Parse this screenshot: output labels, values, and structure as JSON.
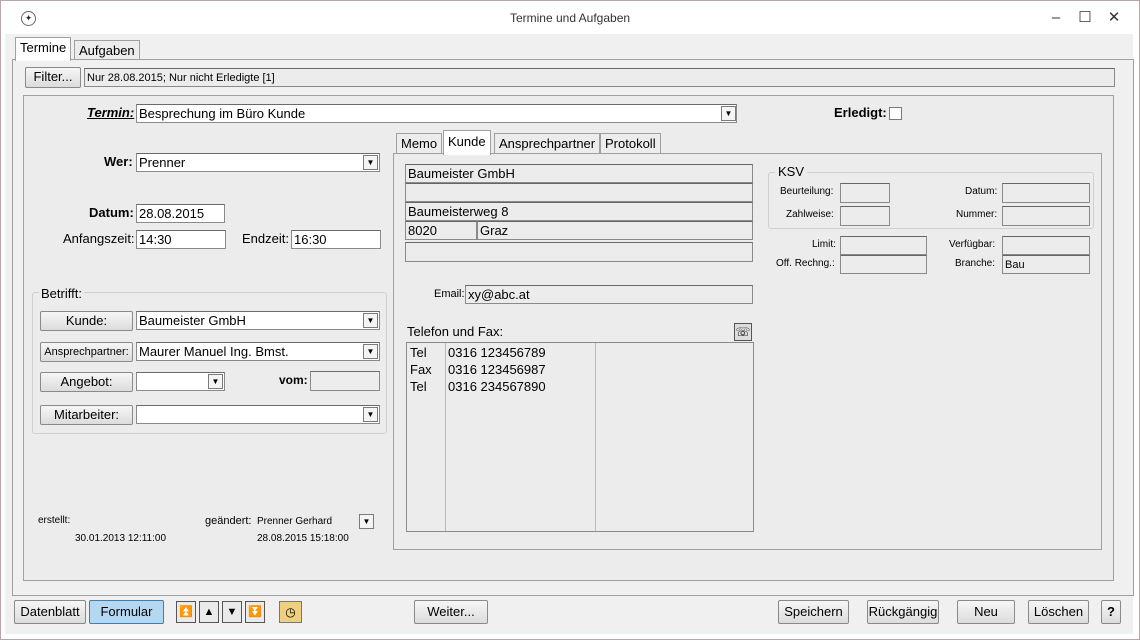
{
  "window": {
    "title": "Termine und Aufgaben",
    "minimize": "–",
    "maximize": "☐",
    "close": "✕"
  },
  "tabs": {
    "termine": "Termine",
    "aufgaben": "Aufgaben"
  },
  "filter": {
    "button": "Filter...",
    "text": "Nur 28.08.2015; Nur nicht Erledigte [1]"
  },
  "termin": {
    "label": "Termin:",
    "value": "Besprechung im Büro Kunde",
    "erledigt_label": "Erledigt:"
  },
  "wer": {
    "label": "Wer:",
    "value": "Prenner"
  },
  "datum": {
    "label": "Datum:",
    "value": "28.08.2015"
  },
  "anfangszeit": {
    "label": "Anfangszeit:",
    "value": "14:30"
  },
  "endzeit": {
    "label": "Endzeit:",
    "value": "16:30"
  },
  "betrifft": {
    "title": "Betrifft:",
    "kunde_btn": "Kunde:",
    "kunde_value": "Baumeister GmbH",
    "ansprech_btn": "Ansprechpartner:",
    "ansprech_value": "Maurer Manuel Ing. Bmst.",
    "angebot_btn": "Angebot:",
    "angebot_value": "",
    "vom_label": "vom:",
    "vom_value": "",
    "mitarbeiter_btn": "Mitarbeiter:",
    "mitarbeiter_value": ""
  },
  "meta": {
    "erstellt_label": "erstellt:",
    "erstellt_value": "30.01.2013 12:11:00",
    "geaendert_label": "geändert:",
    "geaendert_by": "Prenner Gerhard",
    "geaendert_value": "28.08.2015 15:18:00"
  },
  "detail_tabs": [
    "Memo",
    "Kunde",
    "Ansprechpartner",
    "Protokoll"
  ],
  "kunde": {
    "address": [
      "Baumeister GmbH",
      "",
      "Baumeisterweg 8"
    ],
    "plz": "8020",
    "ort": "Graz",
    "extra": "",
    "email_label": "Email:",
    "email": "xy@abc.at",
    "telefon_label": "Telefon und Fax:",
    "phones": [
      {
        "type": "Tel",
        "number": "0316 123456789"
      },
      {
        "type": "Fax",
        "number": "0316 123456987"
      },
      {
        "type": "Tel",
        "number": "0316 234567890"
      }
    ]
  },
  "ksv": {
    "title": "KSV",
    "beurteilung_label": "Beurteilung:",
    "datum_label": "Datum:",
    "zahlweise_label": "Zahlweise:",
    "nummer_label": "Nummer:",
    "limit_label": "Limit:",
    "verfuegbar_label": "Verfügbar:",
    "offrechng_label": "Off. Rechng.:",
    "branche_label": "Branche:",
    "branche_value": "Bau"
  },
  "bottom": {
    "datenblatt": "Datenblatt",
    "formular": "Formular",
    "weiter": "Weiter...",
    "speichern": "Speichern",
    "rueckgaengig": "Rückgängig",
    "neu": "Neu",
    "loeschen": "Löschen",
    "help": "?"
  },
  "colors": {
    "accent": "#b5d8f2",
    "border": "#a0a0a0"
  }
}
